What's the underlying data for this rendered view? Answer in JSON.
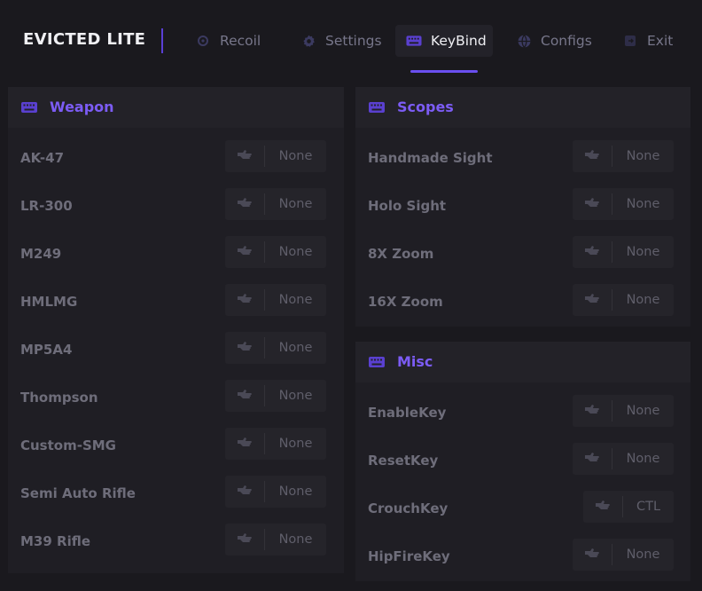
{
  "app": {
    "brand": "EVICTED LITE"
  },
  "nav": [
    {
      "label": "Recoil",
      "icon": "crosshair-icon"
    },
    {
      "label": "Settings",
      "icon": "gear-icon"
    },
    {
      "label": "KeyBind",
      "icon": "keyboard-icon"
    },
    {
      "label": "Configs",
      "icon": "globe-icon"
    },
    {
      "label": "Exit",
      "icon": "exit-icon"
    }
  ],
  "active_tab": "KeyBind",
  "colors": {
    "accent": "#7c5cf5",
    "underline": "#6a4ff0",
    "background": "#1a191e"
  },
  "weapon": {
    "title": "Weapon",
    "rows": [
      {
        "label": "AK-47",
        "key": "None"
      },
      {
        "label": "LR-300",
        "key": "None"
      },
      {
        "label": "M249",
        "key": "None"
      },
      {
        "label": "HMLMG",
        "key": "None"
      },
      {
        "label": "MP5A4",
        "key": "None"
      },
      {
        "label": "Thompson",
        "key": "None"
      },
      {
        "label": "Custom-SMG",
        "key": "None"
      },
      {
        "label": "Semi Auto Rifle",
        "key": "None"
      },
      {
        "label": "M39 Rifle",
        "key": "None"
      }
    ]
  },
  "scopes": {
    "title": "Scopes",
    "rows": [
      {
        "label": "Handmade Sight",
        "key": "None"
      },
      {
        "label": "Holo Sight",
        "key": "None"
      },
      {
        "label": "8X Zoom",
        "key": "None"
      },
      {
        "label": "16X Zoom",
        "key": "None"
      }
    ]
  },
  "misc": {
    "title": "Misc",
    "rows": [
      {
        "label": "EnableKey",
        "key": "None"
      },
      {
        "label": "ResetKey",
        "key": "None"
      },
      {
        "label": "CrouchKey",
        "key": "CTL"
      },
      {
        "label": "HipFireKey",
        "key": "None"
      }
    ]
  }
}
